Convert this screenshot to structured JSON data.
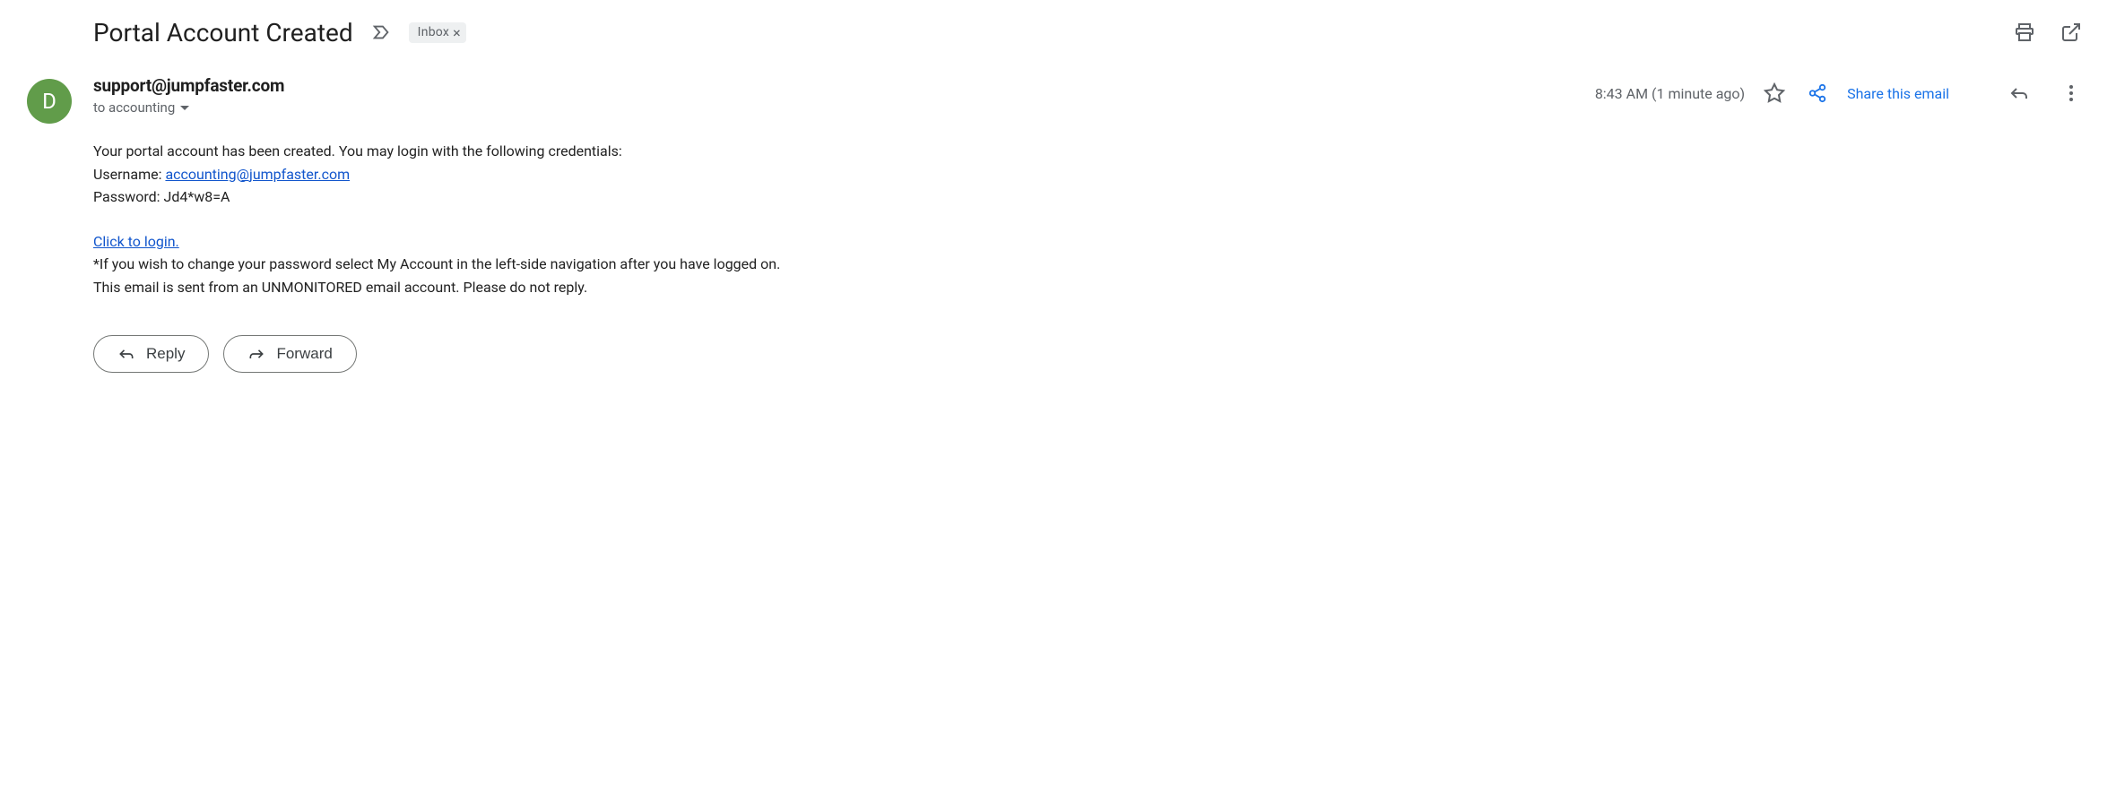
{
  "header": {
    "subject": "Portal Account Created",
    "label": "Inbox"
  },
  "sender": {
    "avatar_initial": "D",
    "from": "support@jumpfaster.com",
    "to_prefix": "to accounting"
  },
  "meta": {
    "timestamp": "8:43 AM (1 minute ago)",
    "share_label": "Share this email"
  },
  "body": {
    "line_intro": "Your portal account has been created. You may login with the following credentials:",
    "username_label": "Username: ",
    "username_value": "accounting@jumpfaster.com",
    "password_label": "Password: ",
    "password_value": "Jd4*w8=A",
    "login_link": "Click to login.",
    "note": "*If you wish to change your password select My Account in the left-side navigation after you have logged on.",
    "footer": "This email is sent from an UNMONITORED email account. Please do not reply."
  },
  "actions": {
    "reply": "Reply",
    "forward": "Forward"
  }
}
